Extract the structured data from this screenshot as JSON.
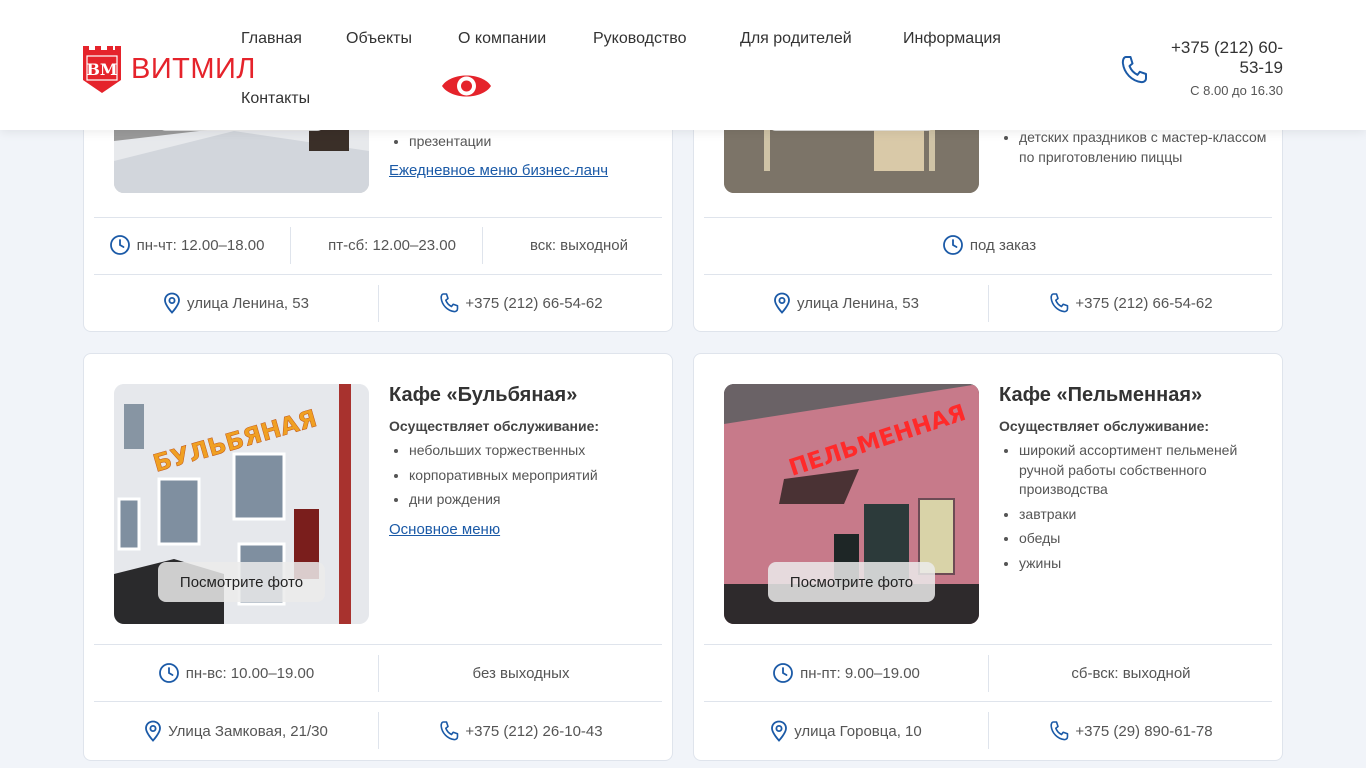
{
  "brand": {
    "name": "ВИТМИЛ",
    "emblem_letters": "BM",
    "color": "#e5232b"
  },
  "nav": {
    "items": [
      "Главная",
      "Объекты",
      "О компании",
      "Руководство",
      "Для родителей",
      "Информация",
      "Контакты"
    ]
  },
  "header_contact": {
    "phone": "+375 (212) 60-53-19",
    "hours": "С 8.00 до 16.30"
  },
  "accent_color": "#1b5aa7",
  "photo_button_label": "Посмотрите фото",
  "cards": [
    {
      "services": [
        "презентации"
      ],
      "menu_link": "Ежедневное меню бизнес-ланч",
      "hours": [
        "пн-чт: 12.00–18.00",
        "пт-сб: 12.00–23.00",
        "вск: выходной"
      ],
      "address": "улица Ленина, 53",
      "phone": "+375 (212) 66-54-62"
    },
    {
      "services": [
        "детских праздников с мастер-классом по приготовлению пиццы"
      ],
      "hours": [
        "под заказ"
      ],
      "address": "улица Ленина, 53",
      "phone": "+375 (212) 66-54-62"
    },
    {
      "title": "Кафе «Бульбяная»",
      "subtitle": "Осуществляет обслуживание:",
      "services": [
        "небольших торжественных",
        "корпоративных мероприятий",
        "дни рождения"
      ],
      "menu_link": "Основное меню",
      "photo_sign": "БУЛЬБЯНАЯ",
      "hours": [
        "пн-вс: 10.00–19.00",
        "без выходных"
      ],
      "address": "Улица Замковая, 21/30",
      "phone": "+375 (212) 26-10-43"
    },
    {
      "title": "Кафе «Пельменная»",
      "subtitle": "Осуществляет обслуживание:",
      "services": [
        "широкий ассортимент пельменей ручной работы собственного производства",
        "завтраки",
        "обеды",
        "ужины"
      ],
      "photo_sign": "ПЕЛЬМЕННАЯ",
      "hours": [
        "пн-пт: 9.00–19.00",
        "сб-вск: выходной"
      ],
      "address": "улица Горовца, 10",
      "phone": "+375 (29) 890-61-78"
    }
  ]
}
